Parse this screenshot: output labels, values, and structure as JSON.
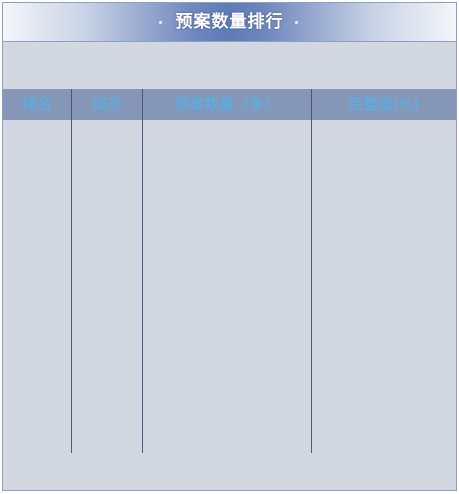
{
  "panel": {
    "title": "预案数量排行"
  },
  "table": {
    "columns": [
      {
        "label": "排名"
      },
      {
        "label": "城市"
      },
      {
        "label": "预案数量（条）"
      },
      {
        "label": "完整度(%)"
      }
    ],
    "rows": []
  },
  "colors": {
    "panel_background": "#d3d7e0",
    "header_background": "#8596b6",
    "header_text": "#4fb3ee",
    "title_text": "#ffffff",
    "title_bar_center": "#5f7bb6",
    "column_divider": "#4b5a78",
    "border": "#8aa0c8"
  }
}
